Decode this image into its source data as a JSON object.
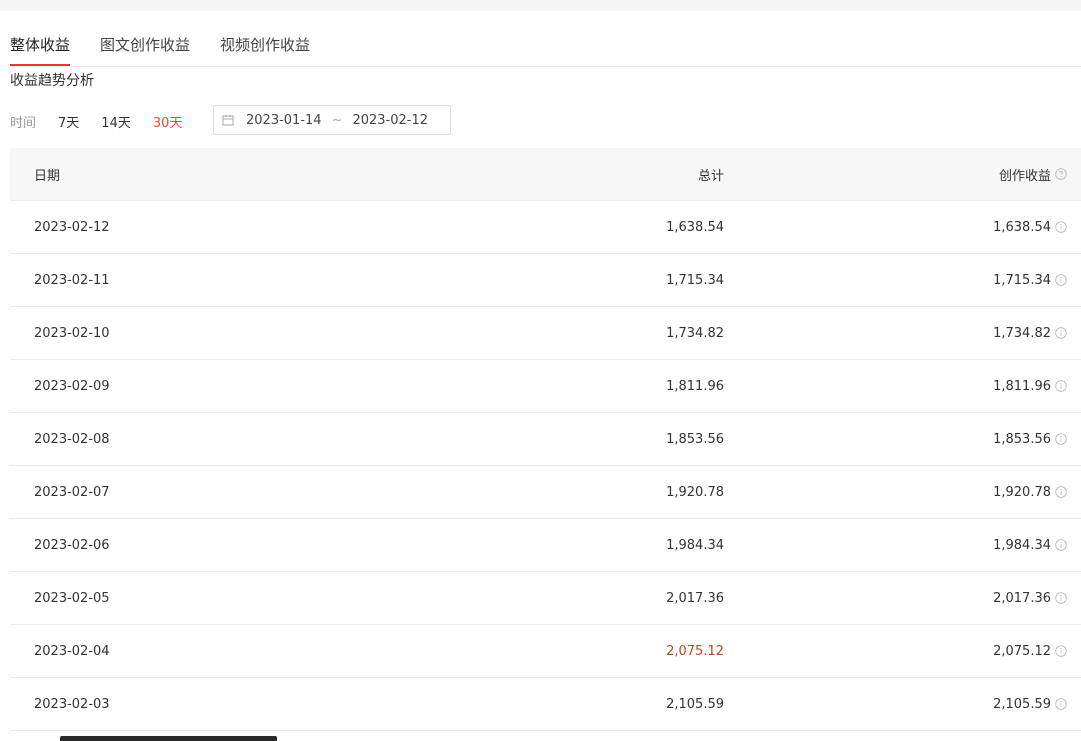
{
  "tabs": [
    {
      "label": "整体收益",
      "active": true
    },
    {
      "label": "图文创作收益",
      "active": false
    },
    {
      "label": "视频创作收益",
      "active": false
    }
  ],
  "section_title": "收益趋势分析",
  "filter": {
    "label": "时间",
    "options": [
      "7天",
      "14天",
      "30天"
    ],
    "active_option": "30天",
    "start_date": "2023-01-14",
    "separator": "~",
    "end_date": "2023-02-12"
  },
  "table": {
    "headers": {
      "date": "日期",
      "total": "总计",
      "earnings": "创作收益"
    },
    "rows": [
      {
        "date": "2023-02-12",
        "total": "1,638.54",
        "earnings": "1,638.54"
      },
      {
        "date": "2023-02-11",
        "total": "1,715.34",
        "earnings": "1,715.34"
      },
      {
        "date": "2023-02-10",
        "total": "1,734.82",
        "earnings": "1,734.82"
      },
      {
        "date": "2023-02-09",
        "total": "1,811.96",
        "earnings": "1,811.96"
      },
      {
        "date": "2023-02-08",
        "total": "1,853.56",
        "earnings": "1,853.56"
      },
      {
        "date": "2023-02-07",
        "total": "1,920.78",
        "earnings": "1,920.78"
      },
      {
        "date": "2023-02-06",
        "total": "1,984.34",
        "earnings": "1,984.34"
      },
      {
        "date": "2023-02-05",
        "total": "2,017.36",
        "earnings": "2,017.36"
      },
      {
        "date": "2023-02-04",
        "total": "2,075.12",
        "earnings": "2,075.12"
      },
      {
        "date": "2023-02-03",
        "total": "2,105.59",
        "earnings": "2,105.59"
      }
    ]
  },
  "colors": {
    "accent": "#e04b3f",
    "tab_underline": "#e03a3a",
    "header_bg": "#f7f7f8"
  },
  "icons": {
    "calendar": "calendar-icon",
    "help": "help-circle-icon",
    "info": "info-circle-icon"
  }
}
